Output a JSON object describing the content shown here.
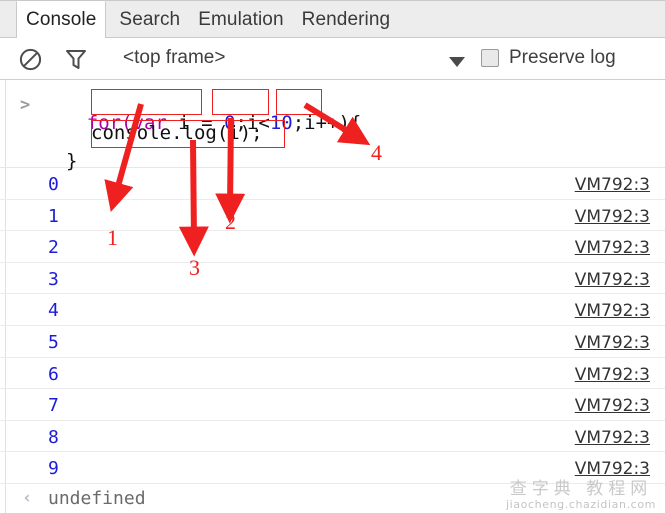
{
  "window": {
    "tabs": [
      {
        "label": "Console",
        "active": true
      },
      {
        "label": "Search",
        "active": false
      },
      {
        "label": "Emulation",
        "active": false
      },
      {
        "label": "Rendering",
        "active": false
      }
    ]
  },
  "toolbar": {
    "clear_icon": "clear-console-icon",
    "filter_icon": "filter-funnel-icon",
    "context_selector": "<top frame>",
    "caret_icon": "chevron-down-icon",
    "preserve_log_label": "Preserve log",
    "preserve_log_checked": false
  },
  "console": {
    "prompt_chevron": ">",
    "input_code": {
      "line1": [
        {
          "t": "for(",
          "c": "kw"
        },
        {
          "t": "var",
          "c": "kw"
        },
        {
          "t": " i = ",
          "c": "plain"
        },
        {
          "t": "0",
          "c": "num"
        },
        {
          "t": ";i<",
          "c": "plain"
        },
        {
          "t": "10",
          "c": "num"
        },
        {
          "t": ";i++){",
          "c": "plain"
        }
      ],
      "line2": "console.log(i);",
      "line3": "}"
    },
    "source_link": "VM792:3",
    "rows": [
      {
        "value": "0",
        "source": "VM792:3"
      },
      {
        "value": "1",
        "source": "VM792:3"
      },
      {
        "value": "2",
        "source": "VM792:3"
      },
      {
        "value": "3",
        "source": "VM792:3"
      },
      {
        "value": "4",
        "source": "VM792:3"
      },
      {
        "value": "5",
        "source": "VM792:3"
      },
      {
        "value": "6",
        "source": "VM792:3"
      },
      {
        "value": "7",
        "source": "VM792:3"
      },
      {
        "value": "8",
        "source": "VM792:3"
      },
      {
        "value": "9",
        "source": "VM792:3"
      }
    ],
    "return_row": {
      "chevron": "‹",
      "value": "undefined"
    }
  },
  "annotations": {
    "color": "#ef2020",
    "labels": [
      {
        "id": "1",
        "text": "1",
        "describes": "var i = 0 initializer"
      },
      {
        "id": "2",
        "text": "2",
        "describes": "i<10 condition"
      },
      {
        "id": "3",
        "text": "3",
        "describes": "console.log(i) body"
      },
      {
        "id": "4",
        "text": "4",
        "describes": "i++ increment"
      }
    ]
  },
  "watermark": {
    "cn": "查字典 教程网",
    "en": "jiaocheng.chazidian.com"
  }
}
